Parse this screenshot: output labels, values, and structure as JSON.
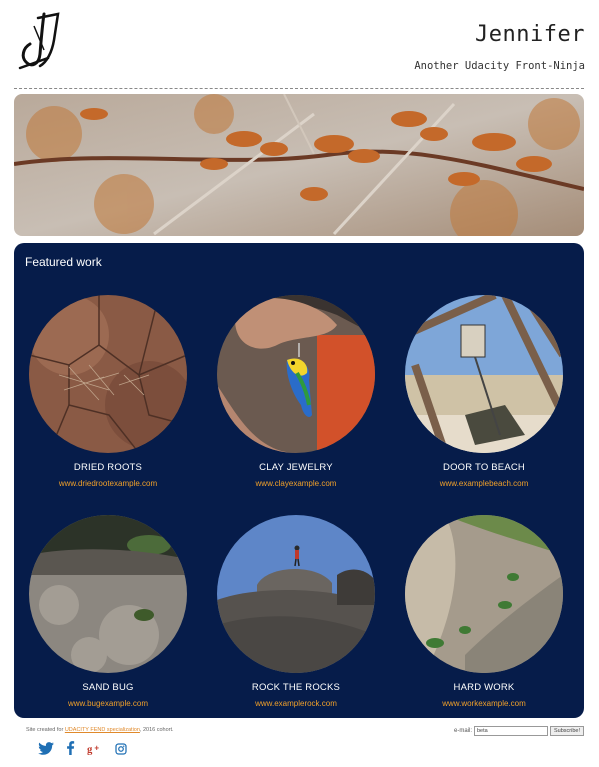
{
  "header": {
    "brand_title": "Jennifer",
    "tagline": "Another Udacity Front-Ninja"
  },
  "featured": {
    "title": "Featured work",
    "items": [
      {
        "title": "DRIED ROOTS",
        "link": "www.driedrootexample.com"
      },
      {
        "title": "CLAY JEWELRY",
        "link": "www.clayexample.com"
      },
      {
        "title": "DOOR TO BEACH",
        "link": "www.examplebeach.com"
      },
      {
        "title": "SAND BUG",
        "link": "www.bugexample.com"
      },
      {
        "title": "ROCK THE ROCKS",
        "link": "www.examplerock.com"
      },
      {
        "title": "HARD WORK",
        "link": "www.workexample.com"
      }
    ]
  },
  "footer": {
    "credit_prefix": "Site created for ",
    "credit_link": "UDACITY FEND specialization",
    "credit_suffix": ", 2016 cohort.",
    "email_label": "e-mail:",
    "email_value": "beta",
    "subscribe_label": "Subscribe!",
    "social_icons": [
      "twitter-icon",
      "facebook-icon",
      "google-plus-icon",
      "instagram-icon"
    ]
  },
  "colors": {
    "featured_bg": "#061c4a",
    "link": "#f0a02a",
    "social": "#1f6fb4"
  }
}
